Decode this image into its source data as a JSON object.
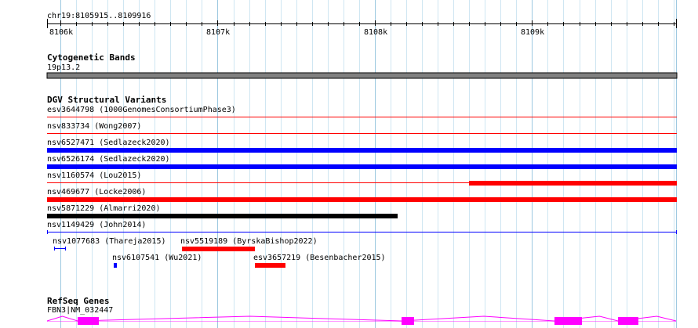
{
  "location": "chr19:8105915..8109916",
  "ruler": {
    "start": 8105915,
    "end": 8109916,
    "ticks": [
      {
        "pos": 8106000,
        "label": "8106k"
      },
      {
        "pos": 8107000,
        "label": "8107k"
      },
      {
        "pos": 8108000,
        "label": "8108k"
      },
      {
        "pos": 8109000,
        "label": "8109k"
      }
    ]
  },
  "tracks": {
    "cytoband": {
      "title": "Cytogenetic Bands",
      "band_label": "19p13.2",
      "band_color": "#808080"
    },
    "dgv": {
      "title": "DGV Structural Variants",
      "colors": {
        "red": "#ff0000",
        "blue": "#0000ff",
        "black": "#000000"
      },
      "full_rows": [
        {
          "label": "esv3644798 (1000GenomesConsortiumPhase3)",
          "start": 8105915,
          "end": 8109916,
          "style": "thin",
          "color": "red"
        },
        {
          "label": "nsv833734 (Wong2007)",
          "start": 8105915,
          "end": 8109916,
          "style": "thin",
          "color": "red"
        },
        {
          "label": "nsv6527471 (Sedlazeck2020)",
          "start": 8105915,
          "end": 8109916,
          "style": "thick",
          "color": "blue"
        },
        {
          "label": "nsv6526174 (Sedlazeck2020)",
          "start": 8105915,
          "end": 8109916,
          "style": "thick",
          "color": "blue"
        },
        {
          "label": "nsv1160574 (Lou2015)",
          "start": 8105915,
          "end": 8109916,
          "style": "thin",
          "color": "red",
          "thick_start": 8108600,
          "thick_end": 8109916
        },
        {
          "label": "nsv469677 (Locke2006)",
          "start": 8105915,
          "end": 8109916,
          "style": "thick",
          "color": "red"
        },
        {
          "label": "nsv5871229 (Almarri2020)",
          "start": 8105915,
          "end": 8108140,
          "style": "thick",
          "color": "black"
        },
        {
          "label": "nsv1149429 (John2014)",
          "start": 8105915,
          "end": 8109916,
          "style": "range",
          "color": "blue"
        }
      ],
      "packed": [
        {
          "label": "nsv1077683 (Thareja2015)",
          "start": 8105960,
          "end": 8106030,
          "style": "range",
          "color": "blue",
          "row": 0
        },
        {
          "label": "nsv5519189 (ByrskaBishop2022)",
          "start": 8106775,
          "end": 8107230,
          "style": "thick",
          "color": "red",
          "row": 0
        },
        {
          "label": "nsv6107541 (Wu2021)",
          "start": 8106340,
          "end": 8106352,
          "style": "thick",
          "color": "blue",
          "row": 1
        },
        {
          "label": "esv3657219 (Besenbacher2015)",
          "start": 8107235,
          "end": 8107425,
          "style": "thick",
          "color": "red",
          "row": 1
        }
      ]
    },
    "refseq": {
      "title": "RefSeq Genes",
      "gene_label": "FBN3|NM_032447",
      "color": "#ff00ff",
      "exons": [
        {
          "start": 8106110,
          "end": 8106240
        },
        {
          "start": 8108170,
          "end": 8108245
        },
        {
          "start": 8109145,
          "end": 8109310
        },
        {
          "start": 8109545,
          "end": 8109670
        }
      ]
    }
  }
}
